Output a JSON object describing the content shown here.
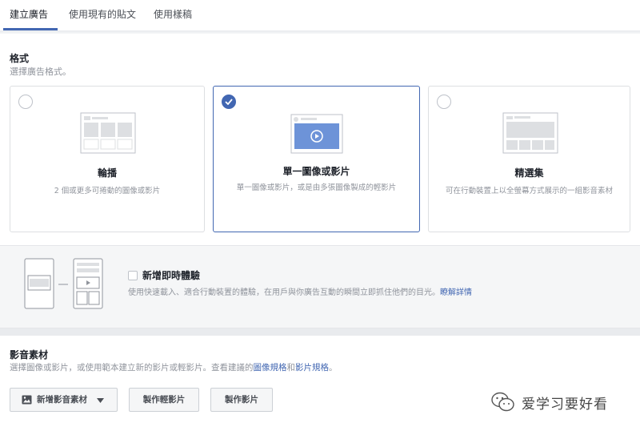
{
  "tabs": [
    {
      "label": "建立廣告",
      "active": true
    },
    {
      "label": "使用現有的貼文",
      "active": false
    },
    {
      "label": "使用樣稿",
      "active": false
    }
  ],
  "format": {
    "title": "格式",
    "subtitle": "選擇廣告格式。",
    "options": [
      {
        "title": "輪播",
        "desc": "2 個或更多可捲動的圖像或影片",
        "selected": false
      },
      {
        "title": "單一圖像或影片",
        "desc": "單一圖像或影片，或是由多張圖像製成的輕影片",
        "selected": true
      },
      {
        "title": "精選集",
        "desc": "可在行動裝置上以全螢幕方式展示的一組影音素材",
        "selected": false
      }
    ]
  },
  "instant_experience": {
    "title": "新增即時體驗",
    "desc": "使用快速載入、適合行動裝置的體驗，在用戶與你廣告互動的瞬間立即抓住他們的目光。",
    "link": "瞭解詳情",
    "checked": false
  },
  "media": {
    "title": "影音素材",
    "subtitle_prefix": "選擇圖像或影片，或使用範本建立新的影片或輕影片。查看建議的",
    "link_image": "圖像規格",
    "and": "和",
    "link_video": "影片規格",
    "period": "。",
    "buttons": {
      "add_media": "新增影音素材",
      "make_slideshow": "製作輕影片",
      "make_video": "製作影片"
    }
  },
  "watermark": {
    "text": "爱学习要好看"
  },
  "colors": {
    "accent": "#4267b2",
    "panel": "#f5f6f7",
    "muted": "#90949c"
  }
}
